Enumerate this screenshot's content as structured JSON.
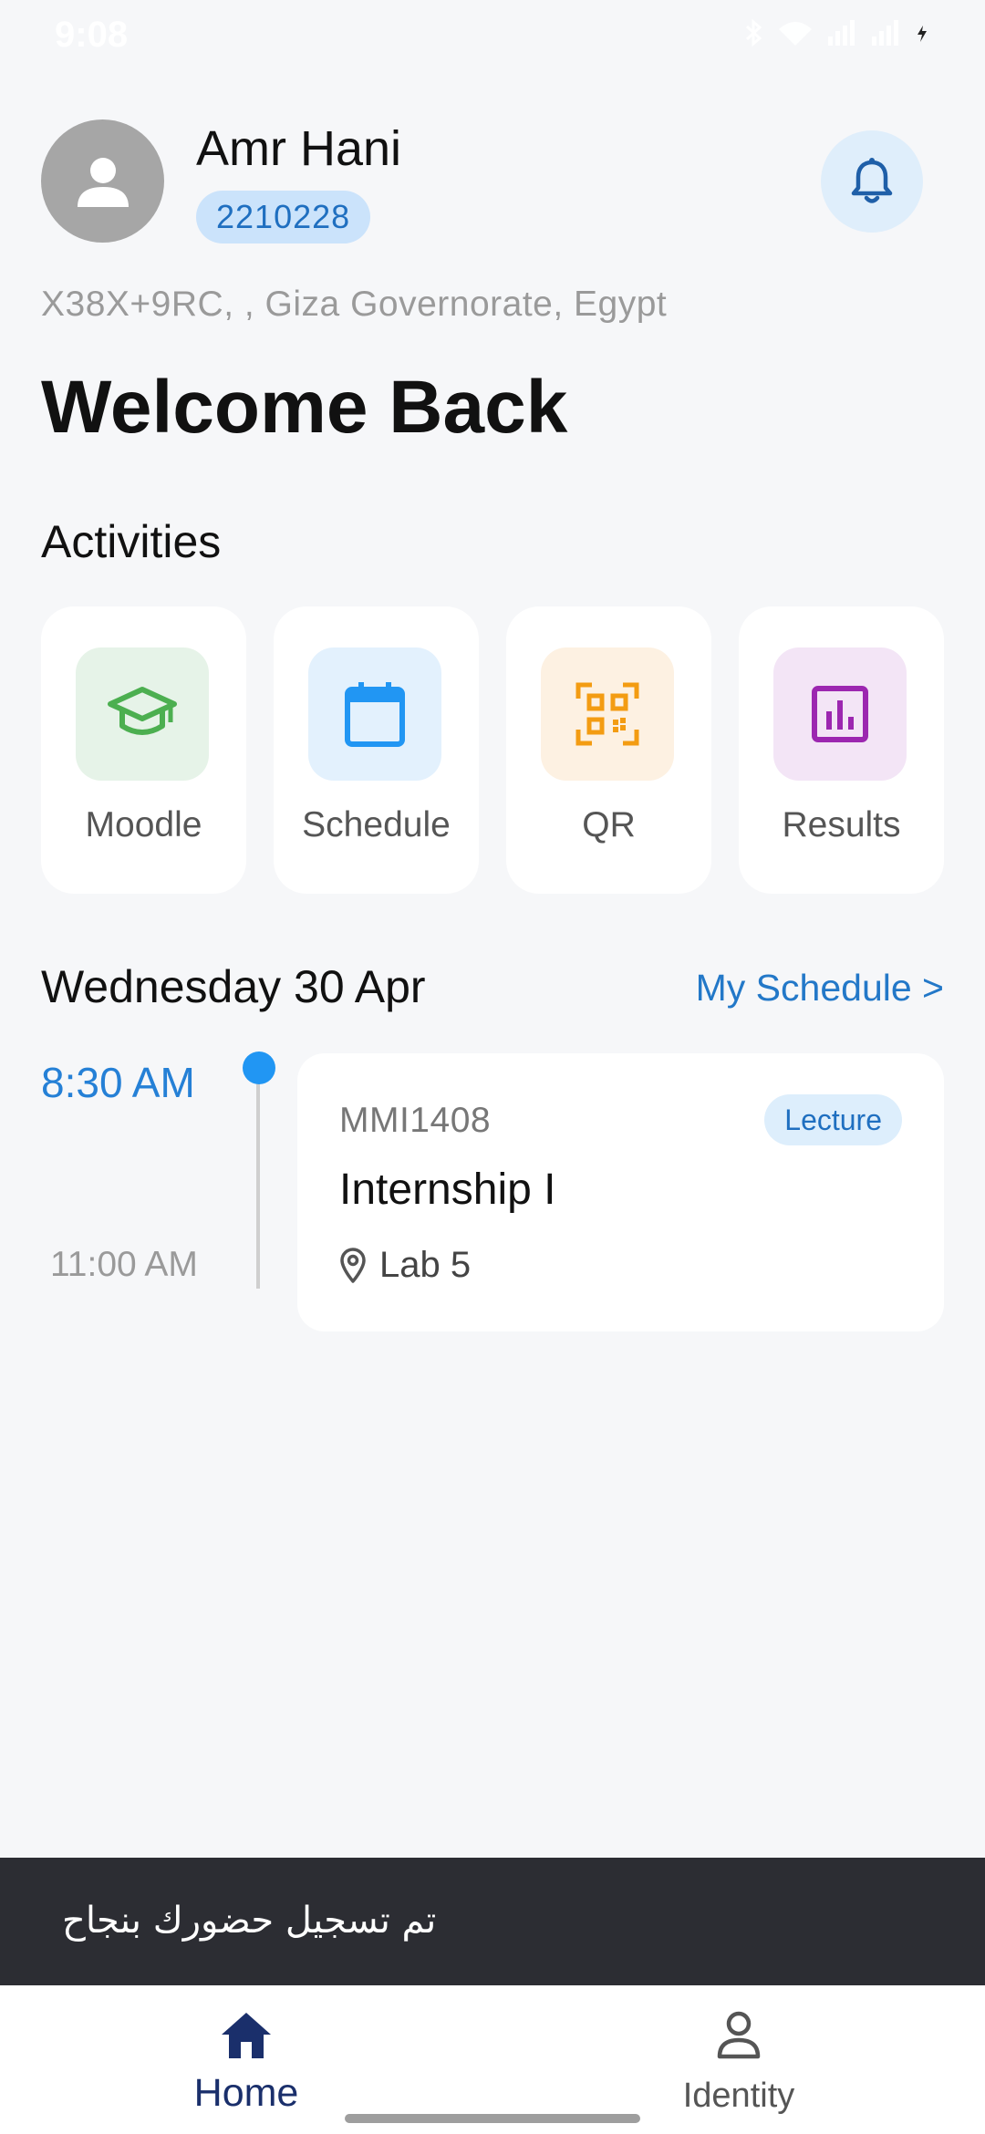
{
  "status_bar": {
    "time": "9:08"
  },
  "profile": {
    "name": "Amr Hani",
    "student_id": "2210228",
    "location": "X38X+9RC, , Giza Governorate, Egypt"
  },
  "greeting": "Welcome Back",
  "activities": {
    "title": "Activities",
    "items": [
      {
        "label": "Moodle",
        "icon": "graduation-cap-icon",
        "color": "#4caf50",
        "bg": "#e6f3e8"
      },
      {
        "label": "Schedule",
        "icon": "calendar-icon",
        "color": "#2196f3",
        "bg": "#e3f1fd"
      },
      {
        "label": "QR",
        "icon": "qr-code-icon",
        "color": "#f39c12",
        "bg": "#fdf1e2"
      },
      {
        "label": "Results",
        "icon": "bar-chart-icon",
        "color": "#9c27b0",
        "bg": "#f3e5f6"
      }
    ]
  },
  "schedule": {
    "day_title": "Wednesday 30 Apr",
    "link_label": "My Schedule >",
    "entries": [
      {
        "start_time": "8:30 AM",
        "end_time": "11:00 AM",
        "course_code": "MMI1408",
        "type": "Lecture",
        "course_name": "Internship I",
        "room": "Lab 5"
      }
    ]
  },
  "snackbar": {
    "message": "تم تسجيل حضورك بنجاح"
  },
  "bottom_nav": {
    "items": [
      {
        "label": "Home",
        "icon": "home-icon",
        "active": true
      },
      {
        "label": "Identity",
        "icon": "person-icon",
        "active": false
      }
    ]
  },
  "colors": {
    "accent": "#2378c8",
    "background": "#f6f7f9",
    "nav_active": "#1a2f6b"
  }
}
